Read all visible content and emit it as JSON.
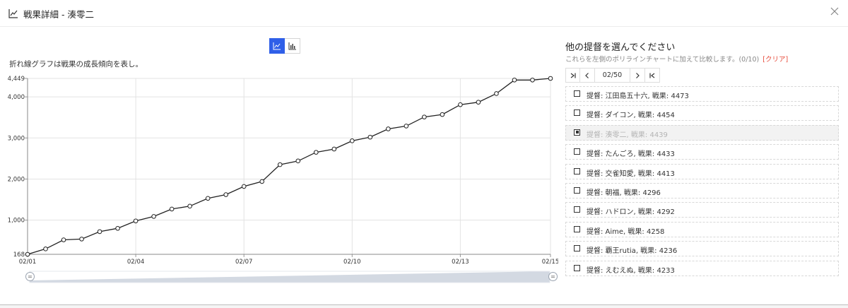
{
  "dialog": {
    "title": "戦果詳細 - 湊零二",
    "title_icon": "line-chart-icon",
    "close_icon": "close-icon"
  },
  "chart_panel": {
    "description": "折れ線グラフは戦果の成長傾向を表し。",
    "toggle": [
      {
        "icon": "line-chart-icon",
        "active": true
      },
      {
        "icon": "bar-chart-icon",
        "active": false
      }
    ]
  },
  "chart_data": {
    "type": "line",
    "title": "",
    "xlabel": "",
    "ylabel": "",
    "x_tick_labels": [
      "02/01",
      "02/04",
      "02/07",
      "02/10",
      "02/13",
      "02/15"
    ],
    "x_tick_positions": [
      0,
      6,
      12,
      18,
      24,
      29
    ],
    "y_ticks": [
      168,
      1000,
      2000,
      3000,
      4000,
      4449
    ],
    "y_tick_labels": [
      "168",
      "1,000",
      "2,000",
      "3,000",
      "4,000",
      "4,449"
    ],
    "ylim": [
      168,
      4449
    ],
    "grid": true,
    "line_color": "#222222",
    "marker_fill": "#ffffff",
    "series": [
      {
        "values": [
          168,
          300,
          520,
          540,
          720,
          800,
          980,
          1090,
          1270,
          1340,
          1530,
          1620,
          1820,
          1940,
          2350,
          2440,
          2650,
          2730,
          2930,
          3020,
          3220,
          3290,
          3510,
          3570,
          3810,
          3870,
          4080,
          4410,
          4410,
          4449
        ]
      }
    ],
    "zoom_range": [
      "02/01",
      "02/15"
    ]
  },
  "compare_panel": {
    "title": "他の提督を選んでください",
    "subtitle": "これらを左側のポリラインチャートに加えて比較します。(0/10)",
    "clear_label": "[クリア]",
    "pager": {
      "first_icon": "first-page-icon",
      "prev_icon": "prev-page-icon",
      "info": "02/50",
      "next_icon": "next-page-icon",
      "last_icon": "last-page-icon"
    },
    "items": [
      {
        "label": "提督: 江田島五十六, 戦果: 4473",
        "checked": false,
        "disabled": false
      },
      {
        "label": "提督: ダイコン, 戦果: 4454",
        "checked": false,
        "disabled": false
      },
      {
        "label": "提督: 湊零二, 戦果: 4439",
        "checked": true,
        "disabled": true
      },
      {
        "label": "提督: たんごろ, 戦果: 4433",
        "checked": false,
        "disabled": false
      },
      {
        "label": "提督: 交雀知愛, 戦果: 4413",
        "checked": false,
        "disabled": false
      },
      {
        "label": "提督: 朝福, 戦果: 4296",
        "checked": false,
        "disabled": false
      },
      {
        "label": "提督: ハドロン, 戦果: 4292",
        "checked": false,
        "disabled": false
      },
      {
        "label": "提督: Aime, 戦果: 4258",
        "checked": false,
        "disabled": false
      },
      {
        "label": "提督: 覇王rutia, 戦果: 4236",
        "checked": false,
        "disabled": false
      },
      {
        "label": "提督: えむえぬ, 戦果: 4233",
        "checked": false,
        "disabled": false
      }
    ]
  }
}
